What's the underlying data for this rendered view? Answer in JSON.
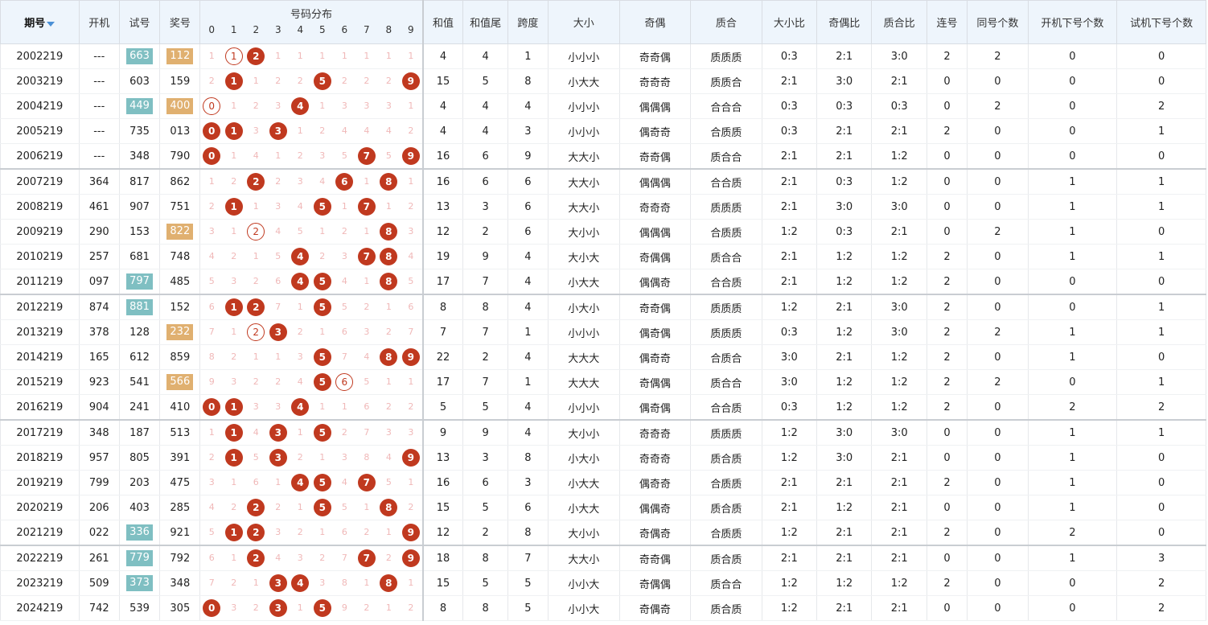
{
  "headers": {
    "issue": "期号",
    "open": "开机",
    "trial": "试号",
    "prize": "奖号",
    "dist": "号码分布",
    "digits": [
      "0",
      "1",
      "2",
      "3",
      "4",
      "5",
      "6",
      "7",
      "8",
      "9"
    ],
    "sum": "和值",
    "sum_tail": "和值尾",
    "span": "跨度",
    "size": "大小",
    "parity": "奇偶",
    "prime": "质合",
    "size_ratio": "大小比",
    "parity_ratio": "奇偶比",
    "prime_ratio": "质合比",
    "consec": "连号",
    "same_count": "同号个数",
    "open_hit": "开机下号个数",
    "trial_hit": "试机下号个数"
  },
  "colors": {
    "hit": "#c0391f",
    "teal_chip": "#7fbfc2",
    "tan_chip": "#e0b070",
    "header_bg": "#eef5fc"
  },
  "rows": [
    {
      "issue": "2002219",
      "open": "---",
      "trial": "663",
      "trial_hl": "teal",
      "prize": "112",
      "prize_hl": "tan",
      "dist": [
        "1",
        "1",
        "2",
        "1",
        "1",
        "1",
        "1",
        "1",
        "1",
        "1"
      ],
      "states": [
        "n",
        "r",
        "h",
        "n",
        "n",
        "n",
        "n",
        "n",
        "n",
        "n"
      ],
      "sum": "4",
      "tail": "4",
      "span": "1",
      "size": "小小小",
      "parity": "奇奇偶",
      "prime": "质质质",
      "sr": "0:3",
      "pr": "2:1",
      "qr": "3:0",
      "consec": "2",
      "same": "2",
      "ohit": "0",
      "thit": "0",
      "sep": false
    },
    {
      "issue": "2003219",
      "open": "---",
      "trial": "603",
      "trial_hl": "",
      "prize": "159",
      "prize_hl": "",
      "dist": [
        "2",
        "1",
        "1",
        "2",
        "2",
        "5",
        "2",
        "2",
        "2",
        "9"
      ],
      "states": [
        "n",
        "h",
        "n",
        "n",
        "n",
        "h",
        "n",
        "n",
        "n",
        "h"
      ],
      "sum": "15",
      "tail": "5",
      "span": "8",
      "size": "小大大",
      "parity": "奇奇奇",
      "prime": "质质合",
      "sr": "2:1",
      "pr": "3:0",
      "qr": "2:1",
      "consec": "0",
      "same": "0",
      "ohit": "0",
      "thit": "0",
      "sep": false
    },
    {
      "issue": "2004219",
      "open": "---",
      "trial": "449",
      "trial_hl": "teal",
      "prize": "400",
      "prize_hl": "tan",
      "dist": [
        "0",
        "1",
        "2",
        "3",
        "4",
        "1",
        "3",
        "3",
        "3",
        "1"
      ],
      "states": [
        "r",
        "n",
        "n",
        "n",
        "h",
        "n",
        "n",
        "n",
        "n",
        "n"
      ],
      "sum": "4",
      "tail": "4",
      "span": "4",
      "size": "小小小",
      "parity": "偶偶偶",
      "prime": "合合合",
      "sr": "0:3",
      "pr": "0:3",
      "qr": "0:3",
      "consec": "0",
      "same": "2",
      "ohit": "0",
      "thit": "2",
      "sep": false
    },
    {
      "issue": "2005219",
      "open": "---",
      "trial": "735",
      "trial_hl": "",
      "prize": "013",
      "prize_hl": "",
      "dist": [
        "0",
        "1",
        "3",
        "3",
        "1",
        "2",
        "4",
        "4",
        "4",
        "2"
      ],
      "states": [
        "h",
        "h",
        "n",
        "h",
        "n",
        "n",
        "n",
        "n",
        "n",
        "n"
      ],
      "sum": "4",
      "tail": "4",
      "span": "3",
      "size": "小小小",
      "parity": "偶奇奇",
      "prime": "合质质",
      "sr": "0:3",
      "pr": "2:1",
      "qr": "2:1",
      "consec": "2",
      "same": "0",
      "ohit": "0",
      "thit": "1",
      "sep": false
    },
    {
      "issue": "2006219",
      "open": "---",
      "trial": "348",
      "trial_hl": "",
      "prize": "790",
      "prize_hl": "",
      "dist": [
        "0",
        "1",
        "4",
        "1",
        "2",
        "3",
        "5",
        "7",
        "5",
        "9"
      ],
      "states": [
        "h",
        "n",
        "n",
        "n",
        "n",
        "n",
        "n",
        "h",
        "n",
        "h"
      ],
      "sum": "16",
      "tail": "6",
      "span": "9",
      "size": "大大小",
      "parity": "奇奇偶",
      "prime": "质合合",
      "sr": "2:1",
      "pr": "2:1",
      "qr": "1:2",
      "consec": "0",
      "same": "0",
      "ohit": "0",
      "thit": "0",
      "sep": false
    },
    {
      "issue": "2007219",
      "open": "364",
      "trial": "817",
      "trial_hl": "",
      "prize": "862",
      "prize_hl": "",
      "dist": [
        "1",
        "2",
        "2",
        "2",
        "3",
        "4",
        "6",
        "1",
        "8",
        "1"
      ],
      "states": [
        "n",
        "n",
        "h",
        "n",
        "n",
        "n",
        "h",
        "n",
        "h",
        "n"
      ],
      "sum": "16",
      "tail": "6",
      "span": "6",
      "size": "大大小",
      "parity": "偶偶偶",
      "prime": "合合质",
      "sr": "2:1",
      "pr": "0:3",
      "qr": "1:2",
      "consec": "0",
      "same": "0",
      "ohit": "1",
      "thit": "1",
      "sep": true
    },
    {
      "issue": "2008219",
      "open": "461",
      "trial": "907",
      "trial_hl": "",
      "prize": "751",
      "prize_hl": "",
      "dist": [
        "2",
        "1",
        "1",
        "3",
        "4",
        "5",
        "1",
        "7",
        "1",
        "2"
      ],
      "states": [
        "n",
        "h",
        "n",
        "n",
        "n",
        "h",
        "n",
        "h",
        "n",
        "n"
      ],
      "sum": "13",
      "tail": "3",
      "span": "6",
      "size": "大大小",
      "parity": "奇奇奇",
      "prime": "质质质",
      "sr": "2:1",
      "pr": "3:0",
      "qr": "3:0",
      "consec": "0",
      "same": "0",
      "ohit": "1",
      "thit": "1",
      "sep": false
    },
    {
      "issue": "2009219",
      "open": "290",
      "trial": "153",
      "trial_hl": "",
      "prize": "822",
      "prize_hl": "tan",
      "dist": [
        "3",
        "1",
        "2",
        "4",
        "5",
        "1",
        "2",
        "1",
        "8",
        "3"
      ],
      "states": [
        "n",
        "n",
        "r",
        "n",
        "n",
        "n",
        "n",
        "n",
        "h",
        "n"
      ],
      "sum": "12",
      "tail": "2",
      "span": "6",
      "size": "大小小",
      "parity": "偶偶偶",
      "prime": "合质质",
      "sr": "1:2",
      "pr": "0:3",
      "qr": "2:1",
      "consec": "0",
      "same": "2",
      "ohit": "1",
      "thit": "0",
      "sep": false
    },
    {
      "issue": "2010219",
      "open": "257",
      "trial": "681",
      "trial_hl": "",
      "prize": "748",
      "prize_hl": "",
      "dist": [
        "4",
        "2",
        "1",
        "5",
        "4",
        "2",
        "3",
        "7",
        "8",
        "4"
      ],
      "states": [
        "n",
        "n",
        "n",
        "n",
        "h",
        "n",
        "n",
        "h",
        "h",
        "n"
      ],
      "sum": "19",
      "tail": "9",
      "span": "4",
      "size": "大小大",
      "parity": "奇偶偶",
      "prime": "质合合",
      "sr": "2:1",
      "pr": "1:2",
      "qr": "1:2",
      "consec": "2",
      "same": "0",
      "ohit": "1",
      "thit": "1",
      "sep": false
    },
    {
      "issue": "2011219",
      "open": "097",
      "trial": "797",
      "trial_hl": "teal",
      "prize": "485",
      "prize_hl": "",
      "dist": [
        "5",
        "3",
        "2",
        "6",
        "4",
        "5",
        "4",
        "1",
        "8",
        "5"
      ],
      "states": [
        "n",
        "n",
        "n",
        "n",
        "h",
        "h",
        "n",
        "n",
        "h",
        "n"
      ],
      "sum": "17",
      "tail": "7",
      "span": "4",
      "size": "小大大",
      "parity": "偶偶奇",
      "prime": "合合质",
      "sr": "2:1",
      "pr": "1:2",
      "qr": "1:2",
      "consec": "2",
      "same": "0",
      "ohit": "0",
      "thit": "0",
      "sep": false
    },
    {
      "issue": "2012219",
      "open": "874",
      "trial": "881",
      "trial_hl": "teal",
      "prize": "152",
      "prize_hl": "",
      "dist": [
        "6",
        "1",
        "2",
        "7",
        "1",
        "5",
        "5",
        "2",
        "1",
        "6"
      ],
      "states": [
        "n",
        "h",
        "h",
        "n",
        "n",
        "h",
        "n",
        "n",
        "n",
        "n"
      ],
      "sum": "8",
      "tail": "8",
      "span": "4",
      "size": "小大小",
      "parity": "奇奇偶",
      "prime": "质质质",
      "sr": "1:2",
      "pr": "2:1",
      "qr": "3:0",
      "consec": "2",
      "same": "0",
      "ohit": "0",
      "thit": "1",
      "sep": true
    },
    {
      "issue": "2013219",
      "open": "378",
      "trial": "128",
      "trial_hl": "",
      "prize": "232",
      "prize_hl": "tan",
      "dist": [
        "7",
        "1",
        "2",
        "3",
        "2",
        "1",
        "6",
        "3",
        "2",
        "7"
      ],
      "states": [
        "n",
        "n",
        "r",
        "h",
        "n",
        "n",
        "n",
        "n",
        "n",
        "n"
      ],
      "sum": "7",
      "tail": "7",
      "span": "1",
      "size": "小小小",
      "parity": "偶奇偶",
      "prime": "质质质",
      "sr": "0:3",
      "pr": "1:2",
      "qr": "3:0",
      "consec": "2",
      "same": "2",
      "ohit": "1",
      "thit": "1",
      "sep": false
    },
    {
      "issue": "2014219",
      "open": "165",
      "trial": "612",
      "trial_hl": "",
      "prize": "859",
      "prize_hl": "",
      "dist": [
        "8",
        "2",
        "1",
        "1",
        "3",
        "5",
        "7",
        "4",
        "8",
        "9"
      ],
      "states": [
        "n",
        "n",
        "n",
        "n",
        "n",
        "h",
        "n",
        "n",
        "h",
        "h"
      ],
      "sum": "22",
      "tail": "2",
      "span": "4",
      "size": "大大大",
      "parity": "偶奇奇",
      "prime": "合质合",
      "sr": "3:0",
      "pr": "2:1",
      "qr": "1:2",
      "consec": "2",
      "same": "0",
      "ohit": "1",
      "thit": "0",
      "sep": false
    },
    {
      "issue": "2015219",
      "open": "923",
      "trial": "541",
      "trial_hl": "",
      "prize": "566",
      "prize_hl": "tan",
      "dist": [
        "9",
        "3",
        "2",
        "2",
        "4",
        "5",
        "6",
        "5",
        "1",
        "1"
      ],
      "states": [
        "n",
        "n",
        "n",
        "n",
        "n",
        "h",
        "r",
        "n",
        "n",
        "n"
      ],
      "sum": "17",
      "tail": "7",
      "span": "1",
      "size": "大大大",
      "parity": "奇偶偶",
      "prime": "质合合",
      "sr": "3:0",
      "pr": "1:2",
      "qr": "1:2",
      "consec": "2",
      "same": "2",
      "ohit": "0",
      "thit": "1",
      "sep": false
    },
    {
      "issue": "2016219",
      "open": "904",
      "trial": "241",
      "trial_hl": "",
      "prize": "410",
      "prize_hl": "",
      "dist": [
        "0",
        "1",
        "3",
        "3",
        "4",
        "1",
        "1",
        "6",
        "2",
        "2"
      ],
      "states": [
        "h",
        "h",
        "n",
        "n",
        "h",
        "n",
        "n",
        "n",
        "n",
        "n"
      ],
      "sum": "5",
      "tail": "5",
      "span": "4",
      "size": "小小小",
      "parity": "偶奇偶",
      "prime": "合合质",
      "sr": "0:3",
      "pr": "1:2",
      "qr": "1:2",
      "consec": "2",
      "same": "0",
      "ohit": "2",
      "thit": "2",
      "sep": false
    },
    {
      "issue": "2017219",
      "open": "348",
      "trial": "187",
      "trial_hl": "",
      "prize": "513",
      "prize_hl": "",
      "dist": [
        "1",
        "1",
        "4",
        "3",
        "1",
        "5",
        "2",
        "7",
        "3",
        "3"
      ],
      "states": [
        "n",
        "h",
        "n",
        "h",
        "n",
        "h",
        "n",
        "n",
        "n",
        "n"
      ],
      "sum": "9",
      "tail": "9",
      "span": "4",
      "size": "大小小",
      "parity": "奇奇奇",
      "prime": "质质质",
      "sr": "1:2",
      "pr": "3:0",
      "qr": "3:0",
      "consec": "0",
      "same": "0",
      "ohit": "1",
      "thit": "1",
      "sep": true
    },
    {
      "issue": "2018219",
      "open": "957",
      "trial": "805",
      "trial_hl": "",
      "prize": "391",
      "prize_hl": "",
      "dist": [
        "2",
        "1",
        "5",
        "3",
        "2",
        "1",
        "3",
        "8",
        "4",
        "9"
      ],
      "states": [
        "n",
        "h",
        "n",
        "h",
        "n",
        "n",
        "n",
        "n",
        "n",
        "h"
      ],
      "sum": "13",
      "tail": "3",
      "span": "8",
      "size": "小大小",
      "parity": "奇奇奇",
      "prime": "质合质",
      "sr": "1:2",
      "pr": "3:0",
      "qr": "2:1",
      "consec": "0",
      "same": "0",
      "ohit": "1",
      "thit": "0",
      "sep": false
    },
    {
      "issue": "2019219",
      "open": "799",
      "trial": "203",
      "trial_hl": "",
      "prize": "475",
      "prize_hl": "",
      "dist": [
        "3",
        "1",
        "6",
        "1",
        "4",
        "5",
        "4",
        "7",
        "5",
        "1"
      ],
      "states": [
        "n",
        "n",
        "n",
        "n",
        "h",
        "h",
        "n",
        "h",
        "n",
        "n"
      ],
      "sum": "16",
      "tail": "6",
      "span": "3",
      "size": "小大大",
      "parity": "偶奇奇",
      "prime": "合质质",
      "sr": "2:1",
      "pr": "2:1",
      "qr": "2:1",
      "consec": "2",
      "same": "0",
      "ohit": "1",
      "thit": "0",
      "sep": false
    },
    {
      "issue": "2020219",
      "open": "206",
      "trial": "403",
      "trial_hl": "",
      "prize": "285",
      "prize_hl": "",
      "dist": [
        "4",
        "2",
        "2",
        "2",
        "1",
        "5",
        "5",
        "1",
        "8",
        "2"
      ],
      "states": [
        "n",
        "n",
        "h",
        "n",
        "n",
        "h",
        "n",
        "n",
        "h",
        "n"
      ],
      "sum": "15",
      "tail": "5",
      "span": "6",
      "size": "小大大",
      "parity": "偶偶奇",
      "prime": "质合质",
      "sr": "2:1",
      "pr": "1:2",
      "qr": "2:1",
      "consec": "0",
      "same": "0",
      "ohit": "1",
      "thit": "0",
      "sep": false
    },
    {
      "issue": "2021219",
      "open": "022",
      "trial": "336",
      "trial_hl": "teal",
      "prize": "921",
      "prize_hl": "",
      "dist": [
        "5",
        "1",
        "2",
        "3",
        "2",
        "1",
        "6",
        "2",
        "1",
        "9"
      ],
      "states": [
        "n",
        "h",
        "h",
        "n",
        "n",
        "n",
        "n",
        "n",
        "n",
        "h"
      ],
      "sum": "12",
      "tail": "2",
      "span": "8",
      "size": "大小小",
      "parity": "奇偶奇",
      "prime": "合质质",
      "sr": "1:2",
      "pr": "2:1",
      "qr": "2:1",
      "consec": "2",
      "same": "0",
      "ohit": "2",
      "thit": "0",
      "sep": false
    },
    {
      "issue": "2022219",
      "open": "261",
      "trial": "779",
      "trial_hl": "teal",
      "prize": "792",
      "prize_hl": "",
      "dist": [
        "6",
        "1",
        "2",
        "4",
        "3",
        "2",
        "7",
        "7",
        "2",
        "9"
      ],
      "states": [
        "n",
        "n",
        "h",
        "n",
        "n",
        "n",
        "n",
        "h",
        "n",
        "h"
      ],
      "sum": "18",
      "tail": "8",
      "span": "7",
      "size": "大大小",
      "parity": "奇奇偶",
      "prime": "质合质",
      "sr": "2:1",
      "pr": "2:1",
      "qr": "2:1",
      "consec": "0",
      "same": "0",
      "ohit": "1",
      "thit": "3",
      "sep": true
    },
    {
      "issue": "2023219",
      "open": "509",
      "trial": "373",
      "trial_hl": "teal",
      "prize": "348",
      "prize_hl": "",
      "dist": [
        "7",
        "2",
        "1",
        "3",
        "4",
        "3",
        "8",
        "1",
        "8",
        "1"
      ],
      "states": [
        "n",
        "n",
        "n",
        "h",
        "h",
        "n",
        "n",
        "n",
        "h",
        "n"
      ],
      "sum": "15",
      "tail": "5",
      "span": "5",
      "size": "小小大",
      "parity": "奇偶偶",
      "prime": "质合合",
      "sr": "1:2",
      "pr": "1:2",
      "qr": "1:2",
      "consec": "2",
      "same": "0",
      "ohit": "0",
      "thit": "2",
      "sep": false
    },
    {
      "issue": "2024219",
      "open": "742",
      "trial": "539",
      "trial_hl": "",
      "prize": "305",
      "prize_hl": "",
      "dist": [
        "0",
        "3",
        "2",
        "3",
        "1",
        "5",
        "9",
        "2",
        "1",
        "2"
      ],
      "states": [
        "h",
        "n",
        "n",
        "h",
        "n",
        "h",
        "n",
        "n",
        "n",
        "n"
      ],
      "sum": "8",
      "tail": "8",
      "span": "5",
      "size": "小小大",
      "parity": "奇偶奇",
      "prime": "质合质",
      "sr": "1:2",
      "pr": "2:1",
      "qr": "2:1",
      "consec": "0",
      "same": "0",
      "ohit": "0",
      "thit": "2",
      "sep": false
    }
  ]
}
